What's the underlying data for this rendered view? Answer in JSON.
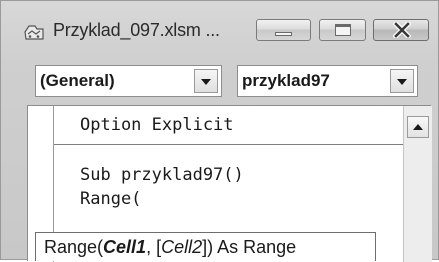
{
  "window": {
    "title": "Przyklad_097.xlsm ..."
  },
  "dropdowns": {
    "object": "(General)",
    "procedure": "przyklad97"
  },
  "code": {
    "lines": [
      "Option Explicit",
      "Sub przyklad97()",
      "Range("
    ]
  },
  "tooltip": {
    "prefix": "Range(",
    "param_bold": "Cell1",
    "sep": ", [",
    "param_italic": "Cell2",
    "suffix": "]) As Range"
  },
  "icons": {
    "app": "vba-module-icon",
    "minimize": "minimize-icon",
    "maximize": "maximize-icon",
    "close": "close-icon",
    "dropdown": "chevron-down-icon",
    "scroll_up": "scroll-up-icon"
  },
  "colors": {
    "background": "#cfcfcf",
    "code_bg": "#ffffff",
    "text": "#1a1a1a"
  }
}
